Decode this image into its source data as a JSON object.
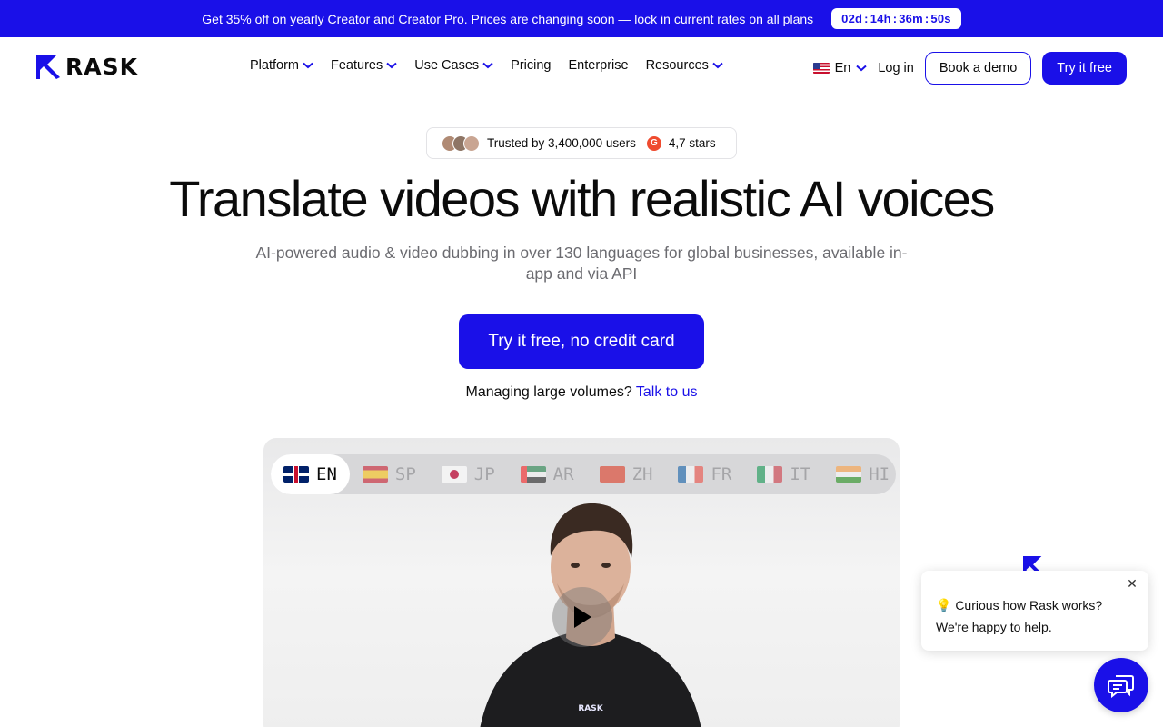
{
  "promo": {
    "text": "Get 35% off on yearly Creator and Creator Pro. Prices are changing soon — lock in current rates on all plans",
    "timer": {
      "days": "02d",
      "hours": "14h",
      "minutes": "36m",
      "seconds": "50s",
      "separator": ":"
    }
  },
  "header": {
    "logo_text": "RASK",
    "nav": [
      "Platform",
      "Features",
      "Use Cases",
      "Pricing",
      "Enterprise",
      "Resources"
    ],
    "language": "En",
    "login": "Log in",
    "book_demo": "Book a demo",
    "try_free": "Try it free"
  },
  "hero": {
    "trust_text": "Trusted by 3,400,000 users",
    "rating": "4,7 stars",
    "g2_badge": "G",
    "title": "Translate videos with realistic AI voices",
    "subtitle": "AI-powered audio & video dubbing in over 130 languages for global businesses, available in-app and via API",
    "cta": "Try it free, no credit card",
    "volumes_text": "Managing large volumes?",
    "volumes_link": "Talk to us"
  },
  "video": {
    "languages": [
      "EN",
      "SP",
      "JP",
      "AR",
      "ZH",
      "FR",
      "IT",
      "HI"
    ],
    "active_language": "EN",
    "shirt_logo": "RASK"
  },
  "chat": {
    "line1": "💡 Curious how Rask works?",
    "line2": "We're happy to help.",
    "close": "✕"
  },
  "colors": {
    "brand": "#1a10e8",
    "text": "#0b0b0b",
    "muted": "#6b6b70"
  },
  "icons": [
    "rask-logo-icon",
    "chevron-down-icon",
    "us-flag-icon",
    "g2-icon",
    "play-icon",
    "chat-icon",
    "close-icon"
  ]
}
